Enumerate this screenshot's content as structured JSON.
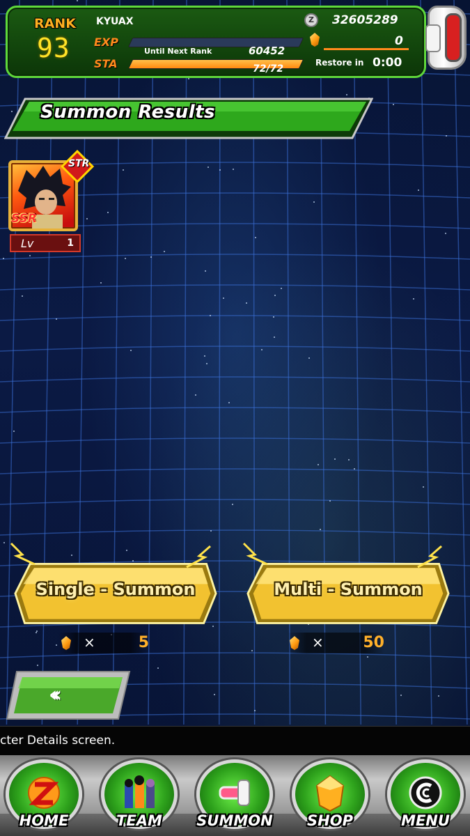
{
  "header": {
    "rank_label": "RANK",
    "rank_value": "93",
    "player_name": "KYUAX",
    "exp_label": "EXP",
    "exp_caption": "Until Next Rank",
    "exp_remaining": "60452",
    "exp_progress": 0.0,
    "sta_label": "STA",
    "stamina": "72/72",
    "stamina_progress": 1.0,
    "zeni": "32605289",
    "dragon_stones": "0",
    "restore_label": "Restore in",
    "restore_time": "0:00"
  },
  "title": "Summon Results",
  "result_card": {
    "type": "STR",
    "rarity": "SSR",
    "level_label": "Lv",
    "level": "1"
  },
  "summon": {
    "single": {
      "label": "Single - Summon",
      "times": "×",
      "cost": "5"
    },
    "multi": {
      "label": "Multi - Summon",
      "times": "×",
      "cost": "50"
    }
  },
  "back_button": {
    "arrows": "‹‹‹"
  },
  "ticker": "cter Details screen.",
  "nav": [
    {
      "label": "HOME",
      "icon": "dragon-ball-z-icon"
    },
    {
      "label": "TEAM",
      "icon": "team-characters-icon"
    },
    {
      "label": "SUMMON",
      "icon": "scouter-icon"
    },
    {
      "label": "SHOP",
      "icon": "dragon-stone-icon"
    },
    {
      "label": "MENU",
      "icon": "capsule-corp-icon"
    }
  ],
  "colors": {
    "header_green": "#1b5a12",
    "accent_orange": "#ff8a1c",
    "rank_yellow": "#ffe227",
    "button_gold": "#f2c230",
    "card_red": "#d11a1a"
  }
}
